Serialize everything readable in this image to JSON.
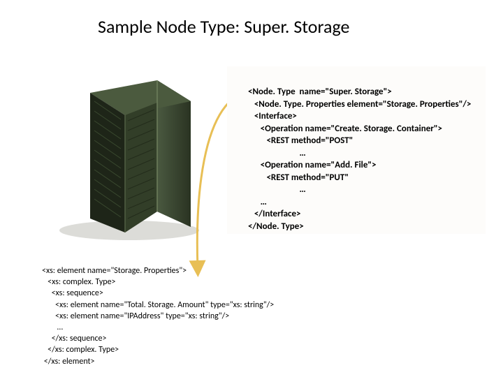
{
  "title": "Sample Node Type: Super. Storage",
  "xmlNodeType": "<Node. Type  name=\"Super. Storage\">\n   <Node. Type. Properties element=\"Storage. Properties\"/>\n   <Interface>\n      <Operation name=\"Create. Storage. Container\">\n         <REST method=\"POST\"\n                         …\n      <Operation name=\"Add. File\">\n         <REST method=\"PUT\"\n                         …\n      …\n   </Interface>\n</Node. Type>",
  "xmlSchema": "<xs: element name=\"Storage. Properties\">\n   <xs: complex. Type>\n     <xs: sequence>\n       <xs: element name=\"Total. Storage. Amount\" type=\"xs: string\"/>\n       <xs: element name=\"IPAddress\" type=\"xs: string\"/>\n        …\n     </xs: sequence>\n   </xs: complex. Type>\n </xs: element>"
}
